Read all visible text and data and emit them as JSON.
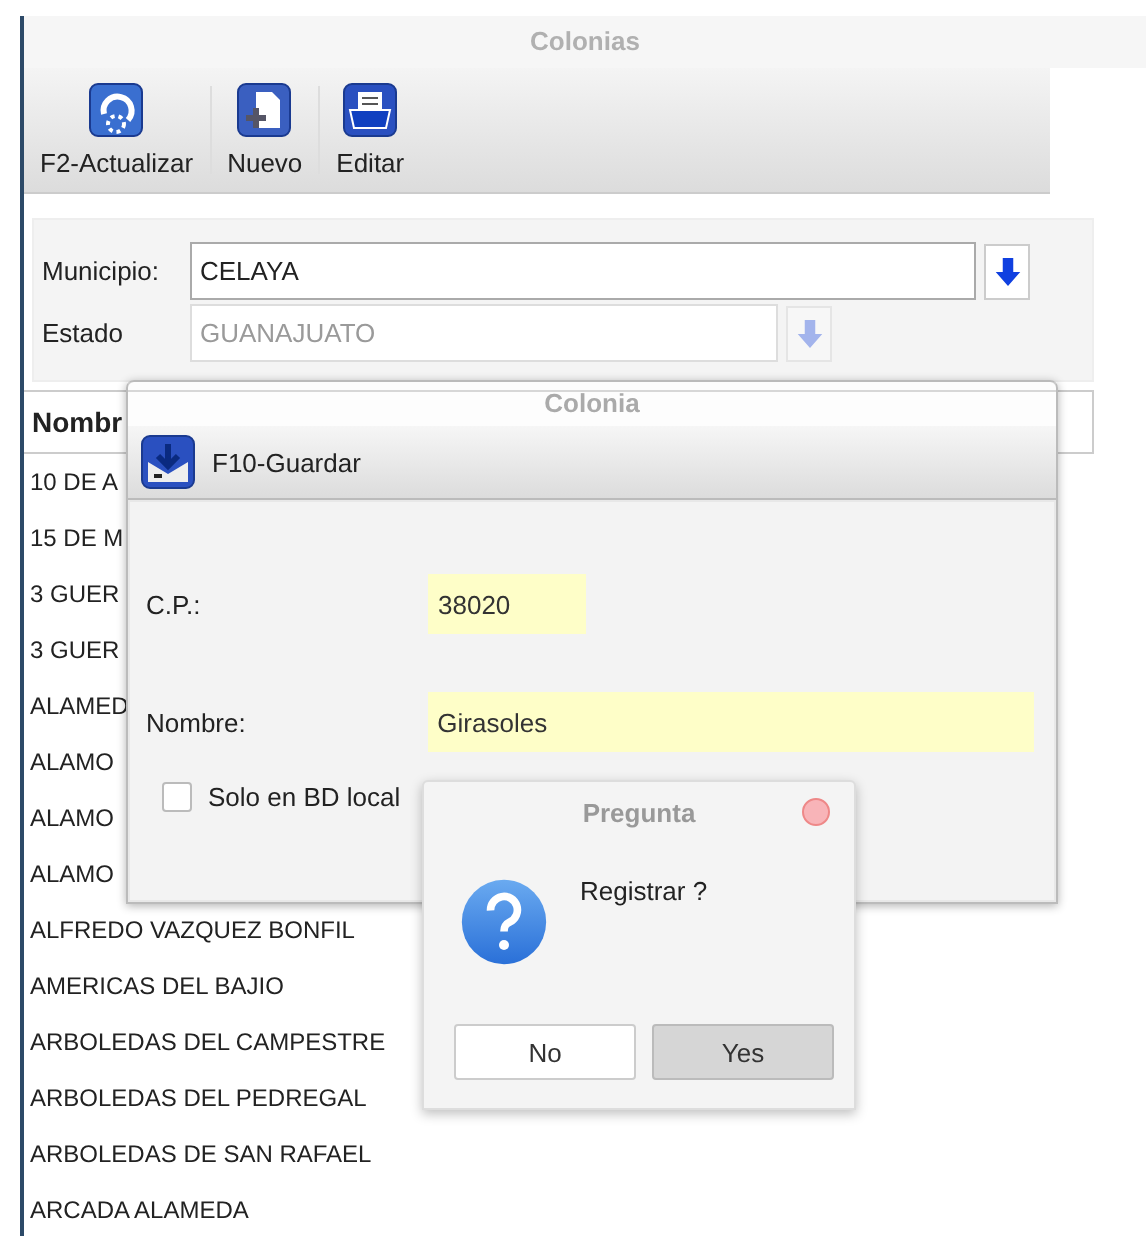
{
  "main_window": {
    "title": "Colonias",
    "toolbar": [
      {
        "kind": "refresh",
        "label": "F2-Actualizar"
      },
      {
        "kind": "new",
        "label": "Nuevo"
      },
      {
        "kind": "edit",
        "label": "Editar"
      }
    ],
    "municipio": {
      "label": "Municipio:",
      "value": "CELAYA"
    },
    "estado": {
      "label": "Estado",
      "value": "GUANAJUATO"
    },
    "table": {
      "columns": [
        "Nombr"
      ],
      "rows": [
        "10 DE A",
        "15 DE M",
        "3 GUER",
        "3 GUER",
        "ALAMED",
        "ALAMO",
        "ALAMO",
        "ALAMO",
        "ALFREDO VAZQUEZ BONFIL",
        "AMERICAS DEL BAJIO",
        "ARBOLEDAS DEL CAMPESTRE",
        "ARBOLEDAS DEL PEDREGAL",
        "ARBOLEDAS DE SAN RAFAEL",
        "ARCADA ALAMEDA"
      ]
    }
  },
  "colonia_dialog": {
    "title": "Colonia",
    "toolbar": [
      {
        "kind": "save",
        "label": "F10-Guardar"
      }
    ],
    "cp": {
      "label": "C.P.:",
      "value": "38020"
    },
    "nombre": {
      "label": "Nombre:",
      "value": "Girasoles"
    },
    "solo_local": {
      "label": "Solo en BD local",
      "checked": false
    }
  },
  "question_dialog": {
    "title": "Pregunta",
    "message": "Registrar ?",
    "buttons": [
      {
        "label": "No",
        "selected": false
      },
      {
        "label": "Yes",
        "selected": true
      }
    ]
  }
}
